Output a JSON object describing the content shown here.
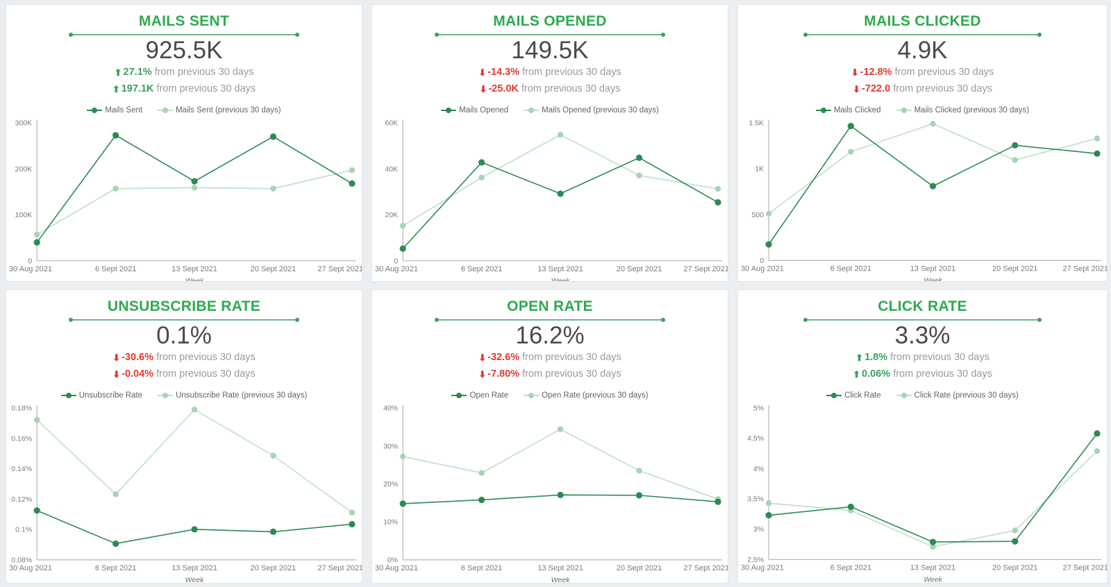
{
  "colors": {
    "title_green": "#2eaa4e",
    "current_series": "#2d8a55",
    "previous_series": "#bfdfc9",
    "up_green": "#3f9e62",
    "down_red": "#e03a32",
    "value_gray": "#4a4a4a",
    "card_bg": "#ffffff",
    "page_bg": "#eceff1"
  },
  "icons": {
    "arrow_up": "arrow-up-icon",
    "arrow_down": "arrow-down-icon",
    "up_glyph": "⬆",
    "down_glyph": "⬇"
  },
  "shared": {
    "x_categories": [
      "30 Aug 2021",
      "6 Sept 2021",
      "13 Sept 2021",
      "20 Sept 2021",
      "27 Sept 2021"
    ],
    "x_axis_title": "Week",
    "previous_suffix": "(previous 30 days)"
  },
  "panels": [
    {
      "id": "mails-sent",
      "title": "MAILS SENT",
      "value": "925.5K",
      "delta_pct": {
        "text": "27.1%",
        "suffix": "from previous 30 days",
        "direction": "up"
      },
      "delta_abs": {
        "text": "197.1K",
        "suffix": "from previous 30 days",
        "direction": "up"
      },
      "legend": {
        "current": "Mails Sent",
        "previous": "Mails Sent (previous 30 days)"
      },
      "chart_data": {
        "type": "line",
        "title": "Mails Sent",
        "xlabel": "Week",
        "ylabel": "",
        "categories": [
          "30 Aug 2021",
          "6 Sept 2021",
          "13 Sept 2021",
          "20 Sept 2021",
          "27 Sept 2021"
        ],
        "ylim": [
          0,
          300000
        ],
        "yticks": [
          0,
          100000,
          200000,
          300000
        ],
        "ytick_labels": [
          "0",
          "100K",
          "200K",
          "300K"
        ],
        "grid": false,
        "legend_position": "top",
        "series": [
          {
            "name": "Mails Sent",
            "values": [
              40000,
              273000,
              173000,
              270000,
              168000
            ]
          },
          {
            "name": "Mails Sent (previous 30 days)",
            "values": [
              57000,
              157000,
              159000,
              157000,
              197000
            ]
          }
        ]
      }
    },
    {
      "id": "mails-opened",
      "title": "MAILS OPENED",
      "value": "149.5K",
      "delta_pct": {
        "text": "-14.3%",
        "suffix": "from previous 30 days",
        "direction": "down"
      },
      "delta_abs": {
        "text": "-25.0K",
        "suffix": "from previous 30 days",
        "direction": "down"
      },
      "legend": {
        "current": "Mails Opened",
        "previous": "Mails Opened (previous 30 days)"
      },
      "chart_data": {
        "type": "line",
        "title": "Mails Opened",
        "xlabel": "Week",
        "ylabel": "",
        "categories": [
          "30 Aug 2021",
          "6 Sept 2021",
          "13 Sept 2021",
          "20 Sept 2021",
          "27 Sept 2021"
        ],
        "ylim": [
          0,
          60000
        ],
        "yticks": [
          0,
          20000,
          40000,
          60000
        ],
        "ytick_labels": [
          "0",
          "20K",
          "40K",
          "60K"
        ],
        "grid": false,
        "legend_position": "top",
        "series": [
          {
            "name": "Mails Opened",
            "values": [
              5300,
              42800,
              29200,
              44800,
              25400
            ]
          },
          {
            "name": "Mails Opened (previous 30 days)",
            "values": [
              15200,
              36200,
              54800,
              37100,
              31300
            ]
          }
        ]
      }
    },
    {
      "id": "mails-clicked",
      "title": "MAILS CLICKED",
      "value": "4.9K",
      "delta_pct": {
        "text": "-12.8%",
        "suffix": "from previous 30 days",
        "direction": "down"
      },
      "delta_abs": {
        "text": "-722.0",
        "suffix": "from previous 30 days",
        "direction": "down"
      },
      "legend": {
        "current": "Mails Clicked",
        "previous": "Mails Clicked (previous 30 days)"
      },
      "chart_data": {
        "type": "line",
        "title": "Mails Clicked",
        "xlabel": "Week",
        "ylabel": "",
        "categories": [
          "30 Aug 2021",
          "6 Sept 2021",
          "13 Sept 2021",
          "20 Sept 2021",
          "27 Sept 2021"
        ],
        "ylim": [
          0,
          1500
        ],
        "yticks": [
          0,
          500,
          1000,
          1500
        ],
        "ytick_labels": [
          "0",
          "500",
          "1K",
          "1.5K"
        ],
        "grid": false,
        "legend_position": "top",
        "series": [
          {
            "name": "Mails Clicked",
            "values": [
              175,
              1465,
              810,
              1255,
              1165
            ]
          },
          {
            "name": "Mails Clicked (previous 30 days)",
            "values": [
              510,
              1185,
              1490,
              1095,
              1330
            ]
          }
        ]
      }
    },
    {
      "id": "unsubscribe-rate",
      "title": "UNSUBSCRIBE RATE",
      "value": "0.1%",
      "delta_pct": {
        "text": "-30.6%",
        "suffix": "from previous 30 days",
        "direction": "down"
      },
      "delta_abs": {
        "text": "-0.04%",
        "suffix": "from previous 30 days",
        "direction": "down"
      },
      "legend": {
        "current": "Unsubscribe Rate",
        "previous": "Unsubscribe Rate (previous 30 days)"
      },
      "chart_data": {
        "type": "line",
        "title": "Unsubscribe Rate",
        "xlabel": "Week",
        "ylabel": "",
        "categories": [
          "30 Aug 2021",
          "6 Sept 2021",
          "13 Sept 2021",
          "20 Sept 2021",
          "27 Sept 2021"
        ],
        "ylim": [
          0.08,
          0.18
        ],
        "yticks": [
          0.08,
          0.1,
          0.12,
          0.14,
          0.16,
          0.18
        ],
        "ytick_labels": [
          "0.08%",
          "0.1%",
          "0.12%",
          "0.14%",
          "0.16%",
          "0.18%"
        ],
        "grid": false,
        "legend_position": "top",
        "series": [
          {
            "name": "Unsubscribe Rate",
            "values": [
              0.1125,
              0.0907,
              0.1001,
              0.0985,
              0.1035
            ]
          },
          {
            "name": "Unsubscribe Rate (previous 30 days)",
            "values": [
              0.1722,
              0.1232,
              0.179,
              0.1486,
              0.1112
            ]
          }
        ]
      }
    },
    {
      "id": "open-rate",
      "title": "OPEN RATE",
      "value": "16.2%",
      "delta_pct": {
        "text": "-32.6%",
        "suffix": "from previous 30 days",
        "direction": "down"
      },
      "delta_abs": {
        "text": "-7.80%",
        "suffix": "from previous 30 days",
        "direction": "down"
      },
      "legend": {
        "current": "Open Rate",
        "previous": "Open Rate (previous 30 days)"
      },
      "chart_data": {
        "type": "line",
        "title": "Open Rate",
        "xlabel": "Week",
        "ylabel": "",
        "categories": [
          "30 Aug 2021",
          "6 Sept 2021",
          "13 Sept 2021",
          "20 Sept 2021",
          "27 Sept 2021"
        ],
        "ylim": [
          0,
          40
        ],
        "yticks": [
          0,
          10,
          20,
          30,
          40
        ],
        "ytick_labels": [
          "0%",
          "10%",
          "20%",
          "30%",
          "40%"
        ],
        "grid": false,
        "legend_position": "top",
        "series": [
          {
            "name": "Open Rate",
            "values": [
              14.8,
              15.8,
              17.1,
              17.0,
              15.3
            ]
          },
          {
            "name": "Open Rate (previous 30 days)",
            "values": [
              27.2,
              22.9,
              34.4,
              23.5,
              16.0
            ]
          }
        ]
      }
    },
    {
      "id": "click-rate",
      "title": "CLICK RATE",
      "value": "3.3%",
      "delta_pct": {
        "text": "1.8%",
        "suffix": "from previous 30 days",
        "direction": "up"
      },
      "delta_abs": {
        "text": "0.06%",
        "suffix": "from previous 30 days",
        "direction": "up"
      },
      "legend": {
        "current": "Click Rate",
        "previous": "Click Rate (previous 30 days)"
      },
      "chart_data": {
        "type": "line",
        "title": "Click Rate",
        "xlabel": "Week",
        "ylabel": "",
        "categories": [
          "30 Aug 2021",
          "6 Sept 2021",
          "13 Sept 2021",
          "20 Sept 2021",
          "27 Sept 2021"
        ],
        "ylim": [
          2.5,
          5
        ],
        "yticks": [
          2.5,
          3,
          3.5,
          4,
          4.5,
          5
        ],
        "ytick_labels": [
          "2.5%",
          "3%",
          "3.5%",
          "4%",
          "4.5%",
          "5%"
        ],
        "grid": false,
        "legend_position": "top",
        "series": [
          {
            "name": "Click Rate",
            "values": [
              3.23,
              3.37,
              2.79,
              2.8,
              4.58
            ]
          },
          {
            "name": "Click Rate (previous 30 days)",
            "values": [
              3.43,
              3.31,
              2.71,
              2.98,
              4.29
            ]
          }
        ]
      }
    }
  ]
}
